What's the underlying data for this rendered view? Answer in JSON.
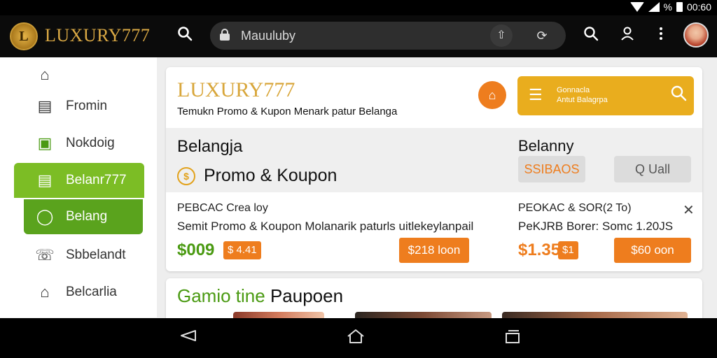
{
  "status_bar": {
    "battery": "%",
    "time": "00:60"
  },
  "app_bar": {
    "logo_letter": "L",
    "brand": "LUXURY777",
    "search_icon": "search-icon",
    "url": "Mauuluby",
    "right_icons": [
      "search-icon",
      "person-icon",
      "more-vert-icon",
      "avatar"
    ]
  },
  "sidebar": {
    "items": [
      {
        "icon": "home-icon",
        "label": ""
      },
      {
        "icon": "store-icon",
        "label": "Fromin"
      },
      {
        "icon": "wallet-icon",
        "label": "Nokdoig"
      },
      {
        "icon": "receipt-icon",
        "label": "Belanr777"
      },
      {
        "icon": "chat-icon",
        "label": "Belang"
      },
      {
        "icon": "phone-icon",
        "label": "Sbbelandt"
      },
      {
        "icon": "house-icon",
        "label": "Belcarlia"
      }
    ]
  },
  "main": {
    "brand": "LUXURY777",
    "subtitle": "Temukn Promo & Kupon Menark patur Belanga",
    "search_box": {
      "line1": "Gonnacla",
      "line2": "Antut Balagrpa"
    },
    "section_left": "Belangja",
    "promo_label": "Promo & Koupon",
    "section_right": "Belanny",
    "btn_left": "SSIBAOS",
    "btn_right": "Q Uall",
    "offer1": {
      "title": "PEBCAC Crea loy",
      "desc": "Semit Promo & Koupon Molanarik paturls uitlekeylanpail",
      "price": "$009",
      "tag": "$ 4.41",
      "button": "$218 loon"
    },
    "offer2": {
      "title": "PEOKAC & SOR(2 To)",
      "desc": "PeKJRB Borer: Somc 1.20JS",
      "price": "$1.35",
      "tag": "$1",
      "button": "$60 oon"
    }
  },
  "bottom_card": {
    "title_green": "Gamio tine",
    "title_dark": " Paupoen"
  },
  "colors": {
    "gold": "#d8a63a",
    "green": "#7cbd25",
    "orange": "#ee7d1e",
    "search_yellow": "#e9ad1e"
  }
}
